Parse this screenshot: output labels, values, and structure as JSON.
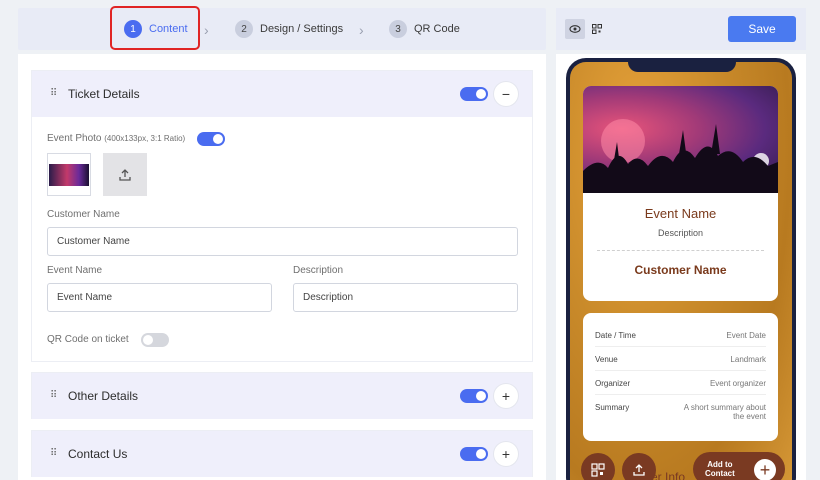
{
  "stepper": {
    "steps": [
      {
        "num": "1",
        "label": "Content"
      },
      {
        "num": "2",
        "label": "Design / Settings"
      },
      {
        "num": "3",
        "label": "QR Code"
      }
    ],
    "active_step": 1
  },
  "sections": {
    "ticket_details": {
      "title": "Ticket Details",
      "toggle_on": true,
      "event_photo_label": "Event Photo",
      "event_photo_hint": "(400x133px, 3:1 Ratio)",
      "customer_name_label": "Customer Name",
      "customer_name_value": "Customer Name",
      "event_name_label": "Event Name",
      "event_name_value": "Event Name",
      "description_label": "Description",
      "description_value": "Description",
      "qr_label": "QR Code on ticket",
      "qr_toggle_on": false
    },
    "other_details": {
      "title": "Other Details",
      "toggle_on": true
    },
    "contact_us": {
      "title": "Contact Us",
      "toggle_on": true
    }
  },
  "toolbar": {
    "save_label": "Save"
  },
  "preview": {
    "event_name": "Event Name",
    "description": "Description",
    "customer_name": "Customer Name",
    "rows": [
      {
        "key": "Date / Time",
        "value": "Event Date"
      },
      {
        "key": "Venue",
        "value": "Landmark"
      },
      {
        "key": "Organizer",
        "value": "Event organizer"
      },
      {
        "key": "Summary",
        "value": "A short summary about the event"
      }
    ],
    "add_contact_line1": "Add to",
    "add_contact_line2": "Contact",
    "peek_text": "er Info"
  },
  "colors": {
    "accent": "#4a6cf0",
    "save": "#4a7af0",
    "brown": "#7a3a22",
    "highlight": "#e02424"
  }
}
